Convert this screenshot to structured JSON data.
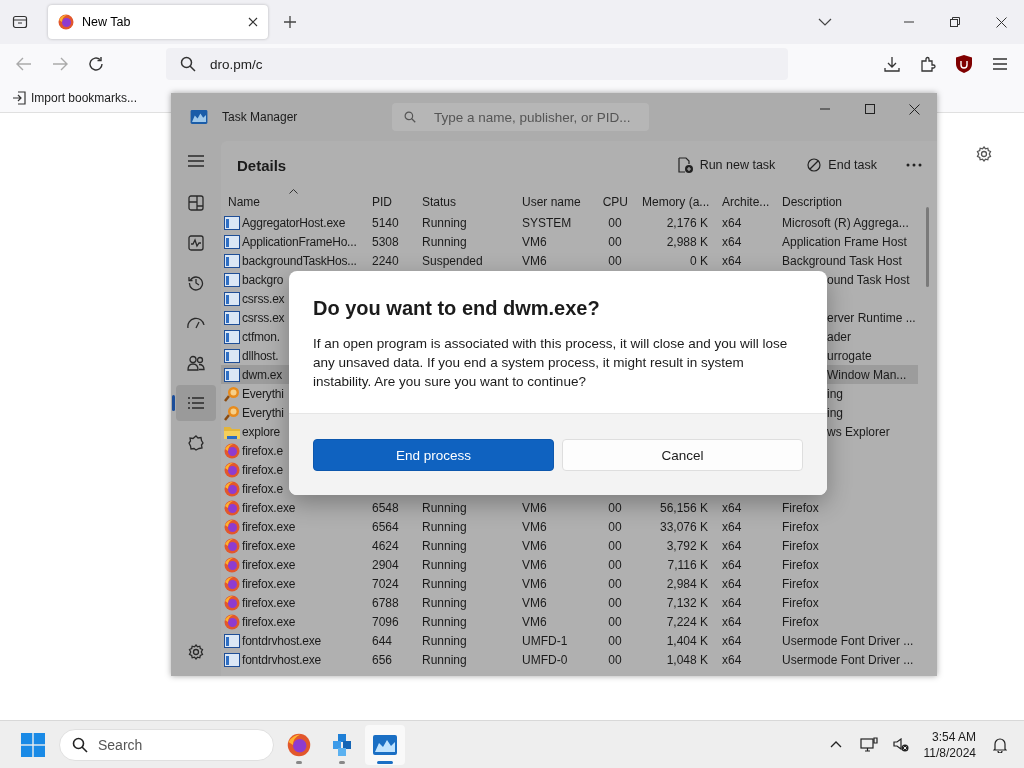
{
  "browser": {
    "tab": {
      "title": "New Tab",
      "selected": true
    },
    "address": "dro.pm/c",
    "bookmark": "Import bookmarks..."
  },
  "task_manager": {
    "title": "Task Manager",
    "search_placeholder": "Type a name, publisher, or PID...",
    "nav": [
      {
        "kind": "processes",
        "selected": false
      },
      {
        "kind": "performance",
        "selected": false
      },
      {
        "kind": "history",
        "selected": false
      },
      {
        "kind": "startup",
        "selected": false
      },
      {
        "kind": "users",
        "selected": false
      },
      {
        "kind": "details",
        "selected": true
      },
      {
        "kind": "services",
        "selected": false
      }
    ],
    "page_title": "Details",
    "actions": [
      "Run new task",
      "End task"
    ],
    "columns": [
      "Name",
      "PID",
      "Status",
      "User name",
      "CPU",
      "Memory (a...",
      "Archite...",
      "Description"
    ],
    "rows": [
      {
        "kind": "app",
        "name": "AggregatorHost.exe",
        "pid": "5140",
        "status": "Running",
        "user": "SYSTEM",
        "cpu": "00",
        "memory": "2,176 K",
        "arch": "x64",
        "description": "Microsoft (R) Aggrega...",
        "selected": false
      },
      {
        "kind": "app",
        "name": "ApplicationFrameHo...",
        "pid": "5308",
        "status": "Running",
        "user": "VM6",
        "cpu": "00",
        "memory": "2,988 K",
        "arch": "x64",
        "description": "Application Frame Host",
        "selected": false
      },
      {
        "kind": "app",
        "name": "backgroundTaskHos...",
        "pid": "2240",
        "status": "Suspended",
        "user": "VM6",
        "cpu": "00",
        "memory": "0 K",
        "arch": "x64",
        "description": "Background Task Host",
        "selected": false
      },
      {
        "kind": "app",
        "name": "backgro",
        "description": "ound Task Host",
        "selected": false
      },
      {
        "kind": "app",
        "name": "csrss.ex",
        "selected": false
      },
      {
        "kind": "app",
        "name": "csrss.ex",
        "description": "erver Runtime ...",
        "selected": false
      },
      {
        "kind": "app",
        "name": "ctfmon.",
        "description": "ader",
        "selected": false
      },
      {
        "kind": "app",
        "name": "dllhost.",
        "description": "urrogate",
        "selected": false
      },
      {
        "kind": "app",
        "name": "dwm.ex",
        "description": "Window Man...",
        "selected": true
      },
      {
        "kind": "search",
        "name": "Everythi",
        "description": "ing",
        "selected": false
      },
      {
        "kind": "search",
        "name": "Everythi",
        "description": "ing",
        "selected": false
      },
      {
        "kind": "folder",
        "name": "explore",
        "description": "ws Explorer",
        "selected": false
      },
      {
        "kind": "firefox",
        "name": "firefox.e",
        "selected": false
      },
      {
        "kind": "firefox",
        "name": "firefox.e",
        "selected": false
      },
      {
        "kind": "firefox",
        "name": "firefox.e",
        "selected": false
      },
      {
        "kind": "firefox",
        "name": "firefox.exe",
        "pid": "6548",
        "status": "Running",
        "user": "VM6",
        "cpu": "00",
        "memory": "56,156 K",
        "arch": "x64",
        "description": "Firefox",
        "selected": false
      },
      {
        "kind": "firefox",
        "name": "firefox.exe",
        "pid": "6564",
        "status": "Running",
        "user": "VM6",
        "cpu": "00",
        "memory": "33,076 K",
        "arch": "x64",
        "description": "Firefox",
        "selected": false
      },
      {
        "kind": "firefox",
        "name": "firefox.exe",
        "pid": "4624",
        "status": "Running",
        "user": "VM6",
        "cpu": "00",
        "memory": "3,792 K",
        "arch": "x64",
        "description": "Firefox",
        "selected": false
      },
      {
        "kind": "firefox",
        "name": "firefox.exe",
        "pid": "2904",
        "status": "Running",
        "user": "VM6",
        "cpu": "00",
        "memory": "7,116 K",
        "arch": "x64",
        "description": "Firefox",
        "selected": false
      },
      {
        "kind": "firefox",
        "name": "firefox.exe",
        "pid": "7024",
        "status": "Running",
        "user": "VM6",
        "cpu": "00",
        "memory": "2,984 K",
        "arch": "x64",
        "description": "Firefox",
        "selected": false
      },
      {
        "kind": "firefox",
        "name": "firefox.exe",
        "pid": "6788",
        "status": "Running",
        "user": "VM6",
        "cpu": "00",
        "memory": "7,132 K",
        "arch": "x64",
        "description": "Firefox",
        "selected": false
      },
      {
        "kind": "firefox",
        "name": "firefox.exe",
        "pid": "7096",
        "status": "Running",
        "user": "VM6",
        "cpu": "00",
        "memory": "7,224 K",
        "arch": "x64",
        "description": "Firefox",
        "selected": false
      },
      {
        "kind": "app",
        "name": "fontdrvhost.exe",
        "pid": "644",
        "status": "Running",
        "user": "UMFD-1",
        "cpu": "00",
        "memory": "1,404 K",
        "arch": "x64",
        "description": "Usermode Font Driver ...",
        "selected": false
      },
      {
        "kind": "app",
        "name": "fontdrvhost.exe",
        "pid": "656",
        "status": "Running",
        "user": "UMFD-0",
        "cpu": "00",
        "memory": "1,048 K",
        "arch": "x64",
        "description": "Usermode Font Driver ...",
        "selected": false
      }
    ]
  },
  "dialog": {
    "title": "Do you want to end dwm.exe?",
    "body": "If an open program is associated with this process, it will close and you will lose any unsaved data. If you end a system process, it might result in system instability. Are you sure you want to continue?",
    "primary": "End process",
    "secondary": "Cancel"
  },
  "taskbar": {
    "search_placeholder": "Search",
    "apps": [
      {
        "kind": "firefox",
        "active": false
      },
      {
        "kind": "cubes",
        "active": false
      },
      {
        "kind": "taskmgr",
        "active": true
      }
    ],
    "time": "3:54 AM",
    "date": "11/8/2024"
  }
}
